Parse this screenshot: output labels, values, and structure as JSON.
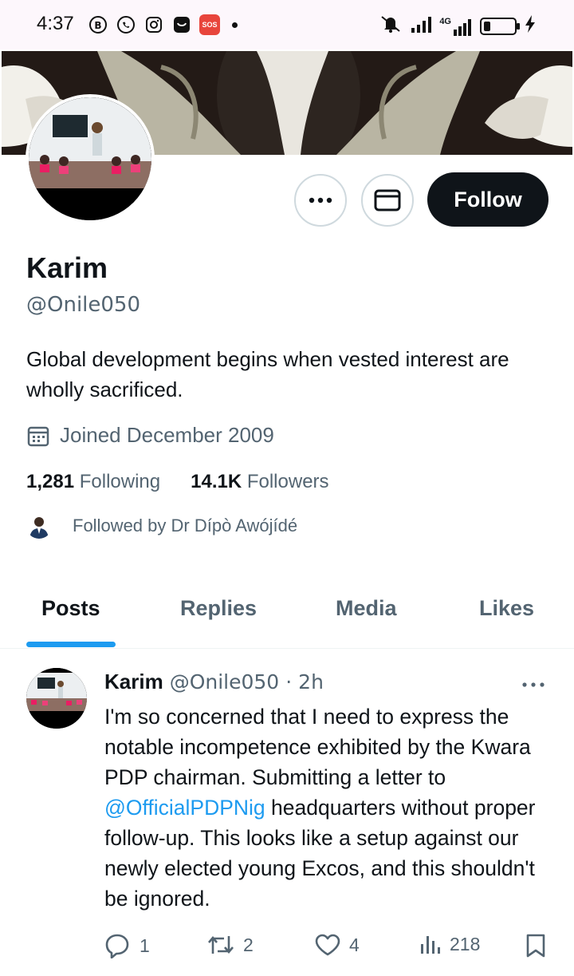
{
  "status_bar": {
    "time": "4:37",
    "sos_label": "SOS",
    "network_label": "4G"
  },
  "profile": {
    "display_name": "Karim",
    "handle": "@Onile050",
    "bio": "Global development begins when vested interest are wholly sacrificed.",
    "joined": "Joined December 2009",
    "following_count": "1,281",
    "following_label": "Following",
    "followers_count": "14.1K",
    "followers_label": "Followers",
    "followed_by": "Followed by Dr Dípò Awójídé",
    "follow_button": "Follow"
  },
  "tabs": [
    {
      "label": "Posts",
      "active": true
    },
    {
      "label": "Replies",
      "active": false
    },
    {
      "label": "Media",
      "active": false
    },
    {
      "label": "Likes",
      "active": false
    }
  ],
  "post": {
    "author_name": "Karim",
    "author_handle": "@Onile050",
    "separator": "·",
    "time": "2h",
    "text_before": "I'm so concerned that I need to express the notable incompetence exhibited by the Kwara PDP chairman. Submitting a letter to ",
    "mention": "@OfficialPDPNig",
    "text_after": " headquarters without proper follow-up. This looks like a setup against our newly elected young Excos, and this shouldn't be ignored.",
    "replies": "1",
    "reposts": "2",
    "likes": "4",
    "views": "218"
  },
  "colors": {
    "accent": "#1d9bf0",
    "text_primary": "#0f1419",
    "text_secondary": "#536471",
    "follow_bg": "#0f1419"
  }
}
